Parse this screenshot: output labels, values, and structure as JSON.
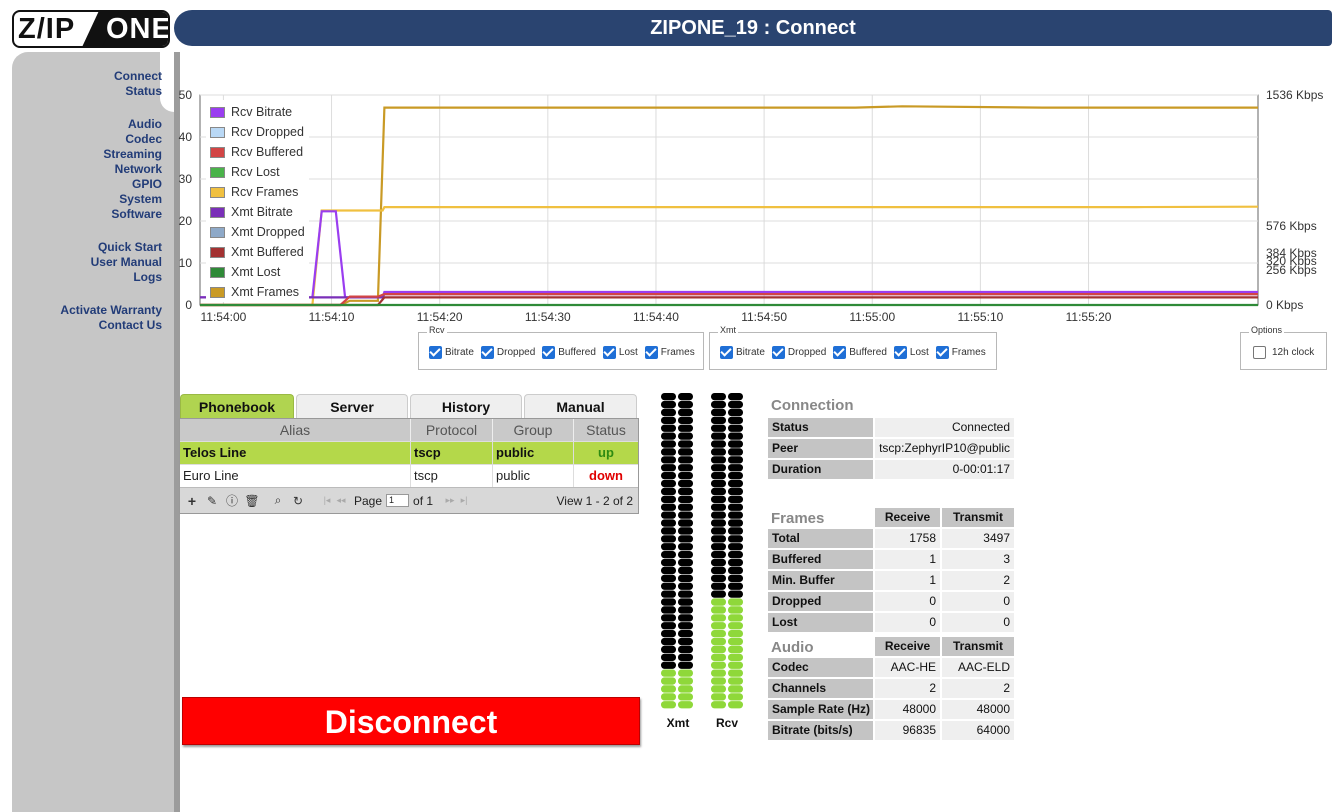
{
  "logo": {
    "left": "Z/IP",
    "right": "ONE"
  },
  "header": {
    "title": "ZIPONE_19 : Connect"
  },
  "sidebar": {
    "group1": [
      "Connect",
      "Status"
    ],
    "group2": [
      "Audio",
      "Codec",
      "Streaming",
      "Network",
      "GPIO",
      "System",
      "Software"
    ],
    "group3": [
      "Quick Start",
      "User Manual",
      "Logs"
    ],
    "group4": [
      "Activate Warranty",
      "Contact Us"
    ]
  },
  "chart_data": {
    "type": "line",
    "title": "",
    "xlabel": "",
    "ylabel": "",
    "x_ticks": [
      "11:54:00",
      "11:54:10",
      "11:54:20",
      "11:54:30",
      "11:54:40",
      "11:54:50",
      "11:55:00",
      "11:55:10",
      "11:55:20"
    ],
    "y_left_ticks": [
      "0",
      "10",
      "20",
      "30",
      "40",
      "50"
    ],
    "y_right_ticks": [
      "0 Kbps",
      "256 Kbps",
      "320 Kbps",
      "384 Kbps",
      "576 Kbps",
      "1536 Kbps"
    ],
    "ylim": [
      0,
      50
    ],
    "grid": true,
    "legend_position": "top-left",
    "series": [
      {
        "name": "Rcv Bitrate",
        "color": "#9a3df0"
      },
      {
        "name": "Rcv Dropped",
        "color": "#b9d8f5"
      },
      {
        "name": "Rcv Buffered",
        "color": "#d24545"
      },
      {
        "name": "Rcv Lost",
        "color": "#4ab34a"
      },
      {
        "name": "Rcv Frames",
        "color": "#f0c040"
      },
      {
        "name": "Xmt Bitrate",
        "color": "#7a2fb8"
      },
      {
        "name": "Xmt Dropped",
        "color": "#8ea9c8"
      },
      {
        "name": "Xmt Buffered",
        "color": "#a33232"
      },
      {
        "name": "Xmt Lost",
        "color": "#2f8a38"
      },
      {
        "name": "Xmt Frames",
        "color": "#c99a25"
      }
    ],
    "lines": {
      "xmt_frames": {
        "color": "#c99a25",
        "points": [
          [
            0,
            0
          ],
          [
            15,
            0
          ],
          [
            16,
            1
          ],
          [
            19,
            1
          ],
          [
            19.7,
            47
          ],
          [
            70,
            47
          ],
          [
            75,
            47.3
          ],
          [
            90,
            47
          ],
          [
            113,
            47
          ]
        ]
      },
      "rcv_frames": {
        "color": "#f0c040",
        "points": [
          [
            0,
            0
          ],
          [
            12,
            0
          ],
          [
            13,
            22.5
          ],
          [
            14.5,
            22.5
          ],
          [
            15.5,
            22.5
          ],
          [
            19.5,
            22.5
          ],
          [
            19.7,
            23.3
          ],
          [
            50,
            23.3
          ],
          [
            100,
            23.3
          ],
          [
            113,
            23.4
          ]
        ]
      },
      "rcv_bitrate": {
        "color": "#9a3df0",
        "points": [
          [
            0,
            1.8
          ],
          [
            12,
            1.8
          ],
          [
            13,
            22.3
          ],
          [
            14.5,
            22.3
          ],
          [
            15.5,
            1.8
          ],
          [
            19.5,
            1.8
          ],
          [
            19.7,
            3.1
          ],
          [
            113,
            3.1
          ]
        ]
      },
      "xmt_bitrate": {
        "color": "#7a2fb8",
        "points": [
          [
            0,
            1.8
          ],
          [
            19.5,
            1.8
          ],
          [
            19.7,
            2.6
          ],
          [
            113,
            2.6
          ]
        ]
      },
      "rcv_buffered": {
        "color": "#d24545",
        "points": [
          [
            0,
            0
          ],
          [
            15,
            0
          ],
          [
            16,
            2
          ],
          [
            19,
            2
          ],
          [
            19.7,
            2.6
          ],
          [
            113,
            2.6
          ]
        ]
      },
      "xmt_buffered": {
        "color": "#a33232",
        "points": [
          [
            0,
            0
          ],
          [
            19,
            0
          ],
          [
            19.7,
            1.8
          ],
          [
            113,
            1.8
          ]
        ]
      },
      "lost": {
        "color": "#2f8a38",
        "points": [
          [
            0,
            0
          ],
          [
            113,
            0
          ]
        ]
      }
    }
  },
  "rcv_group": {
    "label": "Rcv",
    "options": [
      "Bitrate",
      "Dropped",
      "Buffered",
      "Lost",
      "Frames"
    ]
  },
  "xmt_group": {
    "label": "Xmt",
    "options": [
      "Bitrate",
      "Dropped",
      "Buffered",
      "Lost",
      "Frames"
    ]
  },
  "options_group": {
    "label": "Options",
    "clock": "12h clock"
  },
  "tabs": [
    "Phonebook",
    "Server",
    "History",
    "Manual"
  ],
  "phonebook": {
    "headers": [
      "Alias",
      "Protocol",
      "Group",
      "Status"
    ],
    "rows": [
      {
        "alias": "Telos Line",
        "protocol": "tscp",
        "group": "public",
        "status": "up"
      },
      {
        "alias": "Euro Line",
        "protocol": "tscp",
        "group": "public",
        "status": "down"
      }
    ],
    "pager": {
      "page_label": "Page",
      "page_value": "1",
      "of": "of 1",
      "view": "View 1 - 2 of 2"
    }
  },
  "disconnect": {
    "label": "Disconnect"
  },
  "meters": {
    "xmt": {
      "label": "Xmt",
      "level_fraction": 0.12
    },
    "rcv": {
      "label": "Rcv",
      "level_fraction": 0.35
    }
  },
  "connection": {
    "title": "Connection",
    "rows": [
      {
        "label": "Status",
        "value": "Connected"
      },
      {
        "label": "Peer",
        "value": "tscp:ZephyrIP10@public"
      },
      {
        "label": "Duration",
        "value": "0-00:01:17"
      }
    ]
  },
  "frames": {
    "title": "Frames",
    "headers": [
      "Receive",
      "Transmit"
    ],
    "rows": [
      {
        "label": "Total",
        "rx": "1758",
        "tx": "3497"
      },
      {
        "label": "Buffered",
        "rx": "1",
        "tx": "3"
      },
      {
        "label": "Min. Buffer",
        "rx": "1",
        "tx": "2"
      },
      {
        "label": "Dropped",
        "rx": "0",
        "tx": "0"
      },
      {
        "label": "Lost",
        "rx": "0",
        "tx": "0"
      }
    ]
  },
  "audio": {
    "title": "Audio",
    "headers": [
      "Receive",
      "Transmit"
    ],
    "rows": [
      {
        "label": "Codec",
        "rx": "AAC-HE",
        "tx": "AAC-ELD"
      },
      {
        "label": "Channels",
        "rx": "2",
        "tx": "2"
      },
      {
        "label": "Sample Rate (Hz)",
        "rx": "48000",
        "tx": "48000"
      },
      {
        "label": "Bitrate (bits/s)",
        "rx": "96835",
        "tx": "64000"
      }
    ]
  }
}
